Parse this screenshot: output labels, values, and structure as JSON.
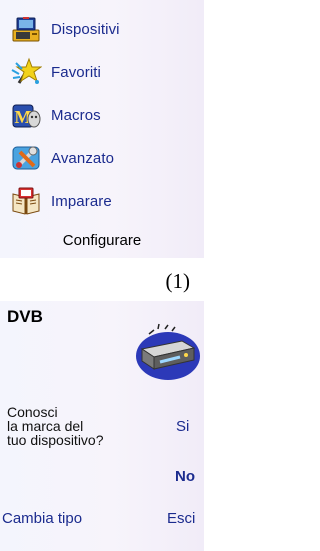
{
  "menu": {
    "items": [
      {
        "label": "Dispositivi",
        "icon": "tv-icon"
      },
      {
        "label": "Favoriti",
        "icon": "star-icon"
      },
      {
        "label": "Macros",
        "icon": "macro-icon"
      },
      {
        "label": "Avanzato",
        "icon": "tools-icon"
      },
      {
        "label": "Imparare",
        "icon": "book-icon"
      }
    ],
    "configure_label": "Configurare"
  },
  "caption": "(1)",
  "device_screen": {
    "title": "DVB",
    "device_icon": "dvb-receiver-icon",
    "question_lines": [
      "Conosci",
      "la marca del",
      "tuo dispositivo?"
    ],
    "yes_label": "Si",
    "no_label": "No",
    "change_type_label": "Cambia tipo",
    "exit_label": "Esci"
  },
  "colors": {
    "link_blue": "#1b2b8e",
    "panel_background": "#f4f5fd"
  }
}
